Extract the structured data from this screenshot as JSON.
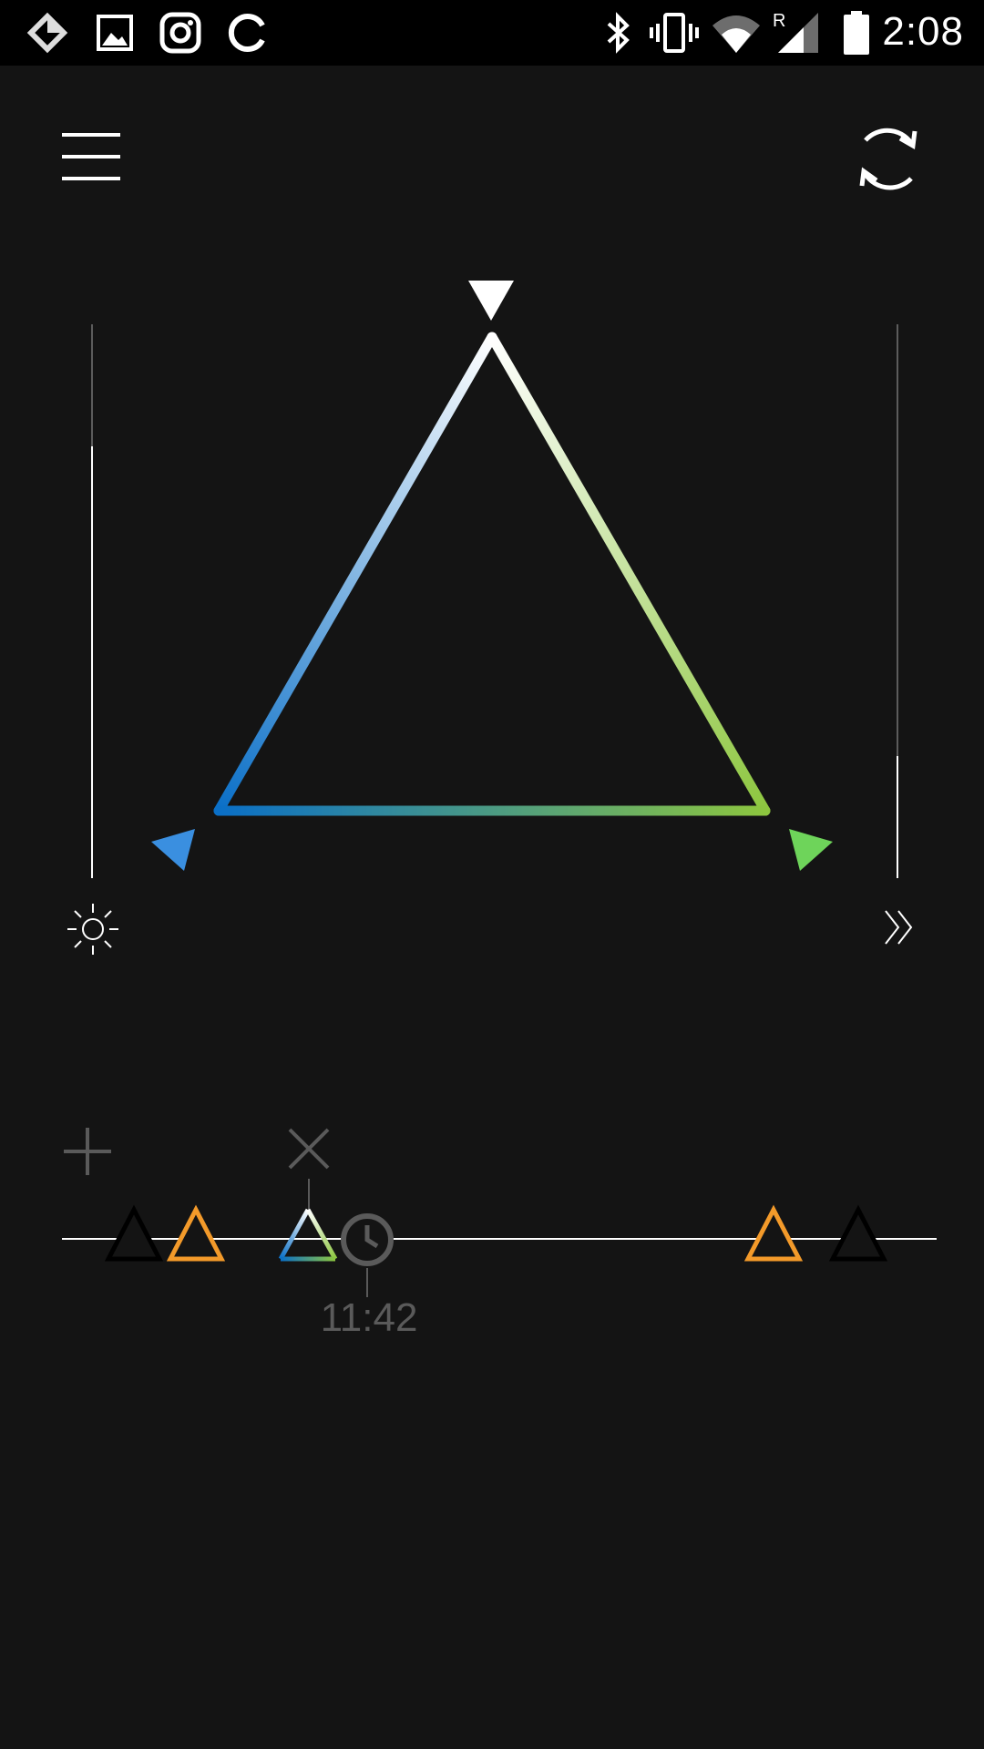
{
  "status_bar": {
    "time": "2:08",
    "left_icons": [
      "app-diamond-icon",
      "gallery-icon",
      "instagram-icon",
      "sync-app-icon"
    ],
    "right_icons": [
      "bluetooth-icon",
      "vibrate-icon",
      "wifi-icon",
      "signal-roaming-icon",
      "battery-icon"
    ],
    "roaming_indicator": "R"
  },
  "toolbar": {
    "menu_icon": "hamburger-menu-icon",
    "refresh_icon": "refresh-icon"
  },
  "color_triangle": {
    "vertex_colors": {
      "top": "#ffffff",
      "left": "#0a6fc7",
      "right": "#8dc63f"
    },
    "marker_colors": {
      "top": "#ffffff",
      "left": "#3a8fe0",
      "right": "#6ed45a"
    }
  },
  "brightness_slider": {
    "icon": "sun-icon",
    "level": 0.78
  },
  "speed_slider": {
    "icon": "double-chevron-right-icon",
    "level": 0.22
  },
  "timeline": {
    "add_icon": "plus-icon",
    "remove_icon": "close-icon",
    "clock_icon": "clock-icon",
    "selected_time": "11:42",
    "preset_colors": {
      "black": "#000000",
      "orange": "#f39a2a",
      "gradient": "tri-color"
    }
  }
}
